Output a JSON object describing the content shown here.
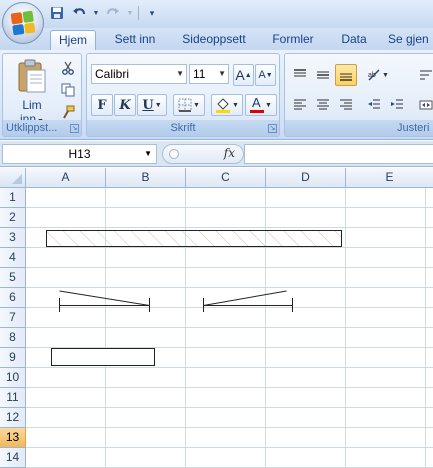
{
  "qat": {
    "save_icon": "save-icon",
    "undo_icon": "undo-icon",
    "redo_icon": "redo-icon",
    "customize_icon": "customize-icon"
  },
  "tabs": [
    {
      "label": "Hjem",
      "active": true
    },
    {
      "label": "Sett inn"
    },
    {
      "label": "Sideoppsett"
    },
    {
      "label": "Formler"
    },
    {
      "label": "Data"
    },
    {
      "label": "Se gjen"
    }
  ],
  "clipboard": {
    "paste_label": "Lim",
    "paste_label2": "inn",
    "group_label": "Utklippst..."
  },
  "font": {
    "name": "Calibri",
    "size": "11",
    "bold": "F",
    "italic": "K",
    "underline": "U",
    "grow": "A",
    "shrink": "A",
    "font_color_letter": "A",
    "group_label": "Skrift"
  },
  "alignment": {
    "group_label": "Justeri"
  },
  "formula_bar": {
    "name_box": "H13",
    "fx": "fx",
    "formula": ""
  },
  "grid": {
    "columns": [
      "A",
      "B",
      "C",
      "D",
      "E"
    ],
    "rows": [
      "1",
      "2",
      "3",
      "4",
      "5",
      "6",
      "7",
      "8",
      "9",
      "10",
      "11",
      "12",
      "13",
      "14"
    ],
    "active_row": "13",
    "active_cell": "H13"
  },
  "colors": {
    "highlight": "#ffd800",
    "font_color": "#e00000",
    "accent": "#15428b"
  }
}
